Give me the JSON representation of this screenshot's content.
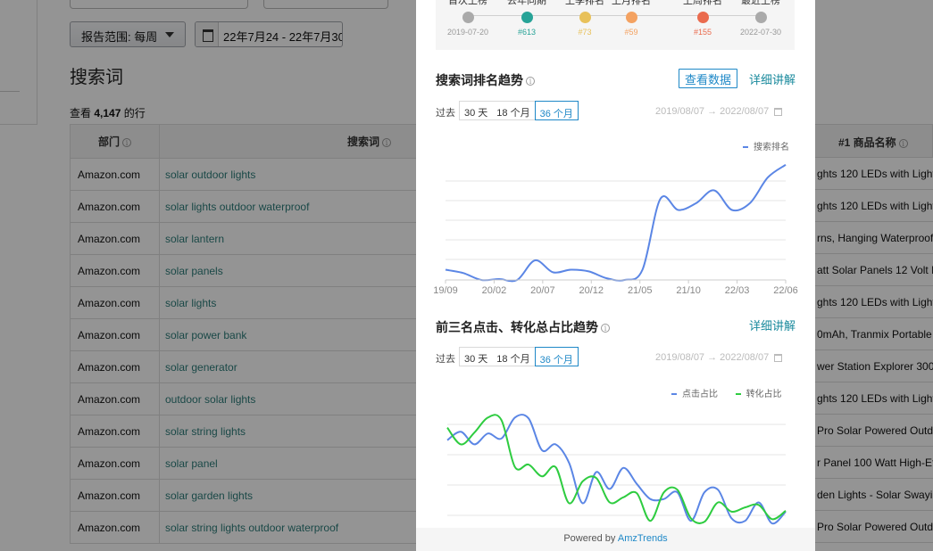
{
  "toolbar": {
    "report_range_label": "报告范围: 每周",
    "date_range_value": "22年7月24 - 22年7月30"
  },
  "page": {
    "title": "搜索词",
    "row_count_prefix": "查看",
    "row_count": "4,147",
    "row_count_suffix": "的行"
  },
  "table": {
    "headers": {
      "department": "部门",
      "search_term": "搜索词",
      "top_product": "#1 商品名称"
    },
    "rows": [
      {
        "department": "Amazon.com",
        "term": "solar outdoor lights",
        "product": "ghts 120 LEDs with Light"
      },
      {
        "department": "Amazon.com",
        "term": "solar lights outdoor waterproof",
        "product": "ghts 120 LEDs with Light"
      },
      {
        "department": "Amazon.com",
        "term": "solar lantern",
        "product": "rns, Hanging Waterproof"
      },
      {
        "department": "Amazon.com",
        "term": "solar panels",
        "product": "att Solar Panels 12 Volt M"
      },
      {
        "department": "Amazon.com",
        "term": "solar lights",
        "product": "ghts 120 LEDs with Light"
      },
      {
        "department": "Amazon.com",
        "term": "solar power bank",
        "product": "0mAh, Tranmix Portable S"
      },
      {
        "department": "Amazon.com",
        "term": "solar generator",
        "product": "wer Station Explorer 300,"
      },
      {
        "department": "Amazon.com",
        "term": "outdoor solar lights",
        "product": "ghts 120 LEDs with Light"
      },
      {
        "department": "Amazon.com",
        "term": "solar string lights",
        "product": "Pro Solar Powered Outdo"
      },
      {
        "department": "Amazon.com",
        "term": "solar panel",
        "product": "r Panel 100 Watt High-Ef"
      },
      {
        "department": "Amazon.com",
        "term": "solar garden lights",
        "product": "den Lights - Solar Swayin"
      },
      {
        "department": "Amazon.com",
        "term": "solar string lights outdoor waterproof",
        "product": "Pro Solar Powered Outdo"
      }
    ]
  },
  "popup": {
    "timeline": [
      {
        "label": "首次上榜",
        "value": "2019-07-20",
        "color": "#aaaaaa"
      },
      {
        "label": "去年同期",
        "value": "#613",
        "color": "#27a397"
      },
      {
        "label": "上季排名",
        "value": "#73",
        "color": "#e8c15a"
      },
      {
        "label": "上月排名",
        "value": "#59",
        "color": "#f4a261"
      },
      {
        "label": "上周排名",
        "value": "#155",
        "color": "#ea6b4e"
      },
      {
        "label": "最近上榜",
        "value": "2022-07-30",
        "color": "#aaaaaa"
      }
    ],
    "rank_section": {
      "title": "搜索词排名趋势",
      "view_data_button": "查看数据",
      "detail_link": "详细讲解",
      "period_label": "过去",
      "periods": [
        "30 天",
        "18 个月",
        "36 个月"
      ],
      "active_period": "36 个月",
      "date_range": "2019/08/07 → 2022/08/07"
    },
    "share_section": {
      "title": "前三名点击、转化总占比趋势",
      "detail_link": "详细讲解",
      "period_label": "过去",
      "periods": [
        "30 天",
        "18 个月",
        "36 个月"
      ],
      "active_period": "36 个月",
      "date_range": "2019/08/07 → 2022/08/07"
    },
    "footer_prefix": "Powered by",
    "footer_brand": "AmzTrends"
  },
  "chart_data": [
    {
      "type": "line",
      "title": "搜索词排名趋势",
      "x_ticks": [
        "19/09",
        "20/02",
        "20/07",
        "20/12",
        "21/05",
        "21/10",
        "22/03",
        "22/06"
      ],
      "series": [
        {
          "name": "搜索排名",
          "color": "#5b86e5",
          "values": [
            12,
            8,
            0,
            1,
            0,
            23,
            9,
            12,
            10,
            2,
            0,
            12,
            95,
            82,
            90,
            105,
            82,
            90,
            120,
            135
          ]
        }
      ],
      "ylim": [
        0,
        140
      ],
      "grid": true,
      "legend": "top-right"
    },
    {
      "type": "line",
      "title": "前三名点击、转化总占比趋势",
      "series": [
        {
          "name": "点击占比",
          "color": "#5b86e5",
          "values": [
            100,
            110,
            95,
            108,
            102,
            127,
            126,
            88,
            95,
            73,
            25,
            62,
            42,
            67,
            48,
            30,
            30,
            38,
            4,
            38,
            41,
            7,
            4,
            26,
            1,
            15
          ]
        },
        {
          "name": "转化占比",
          "color": "#2ecc40",
          "values": [
            115,
            95,
            109,
            127,
            124,
            68,
            71,
            57,
            68,
            25,
            51,
            55,
            26,
            32,
            37,
            4,
            38,
            41,
            7,
            3,
            26,
            15,
            20,
            23,
            6,
            16
          ]
        }
      ],
      "ylim": [
        0,
        140
      ],
      "grid": true,
      "legend": "top-right"
    }
  ]
}
